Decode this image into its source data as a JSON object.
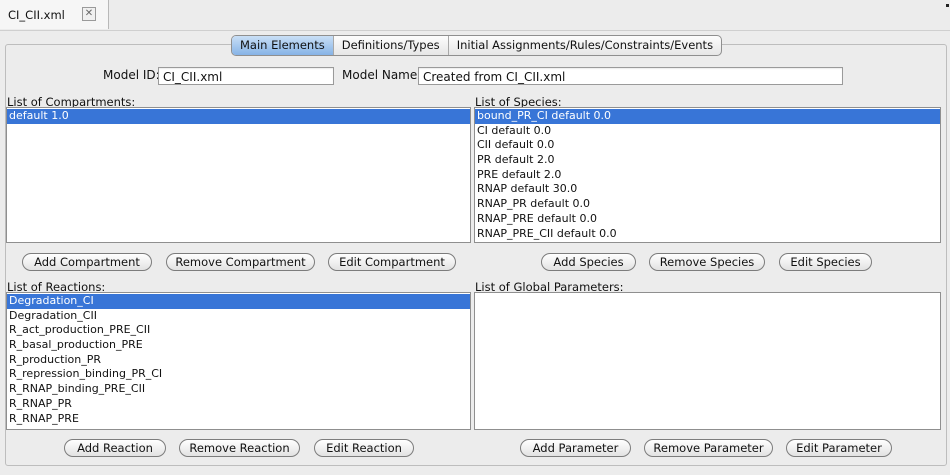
{
  "doc_tab": {
    "title": "CI_CII.xml",
    "close_icon": "close-icon"
  },
  "tabs": [
    {
      "label": "Main Elements",
      "active": true
    },
    {
      "label": "Definitions/Types",
      "active": false
    },
    {
      "label": "Initial Assignments/Rules/Constraints/Events",
      "active": false
    }
  ],
  "model": {
    "id_label": "Model ID:",
    "id_value": "CI_CII.xml",
    "name_label": "Model Name:",
    "name_value": "Created from CI_CII.xml"
  },
  "compartments": {
    "label": "List of Compartments:",
    "items": [
      "default 1.0"
    ],
    "selected_index": 0,
    "buttons": {
      "add": "Add Compartment",
      "remove": "Remove Compartment",
      "edit": "Edit Compartment"
    }
  },
  "species": {
    "label": "List of Species:",
    "items": [
      "bound_PR_CI default 0.0",
      "CI default 0.0",
      "CII default 0.0",
      "PR default 2.0",
      "PRE default 2.0",
      "RNAP default 30.0",
      "RNAP_PR default 0.0",
      "RNAP_PRE default 0.0",
      "RNAP_PRE_CII default 0.0"
    ],
    "selected_index": 0,
    "buttons": {
      "add": "Add Species",
      "remove": "Remove Species",
      "edit": "Edit Species"
    }
  },
  "reactions": {
    "label": "List of Reactions:",
    "items": [
      "Degradation_CI",
      "Degradation_CII",
      "R_act_production_PRE_CII",
      "R_basal_production_PRE",
      "R_production_PR",
      "R_repression_binding_PR_CI",
      "R_RNAP_binding_PRE_CII",
      "R_RNAP_PR",
      "R_RNAP_PRE"
    ],
    "selected_index": 0,
    "buttons": {
      "add": "Add Reaction",
      "remove": "Remove Reaction",
      "edit": "Edit Reaction"
    }
  },
  "parameters": {
    "label": "List of Global Parameters:",
    "items": [],
    "buttons": {
      "add": "Add Parameter",
      "remove": "Remove Parameter",
      "edit": "Edit Parameter"
    }
  },
  "colors": {
    "selection": "#3875d7",
    "active_tab": "#86b3e6"
  }
}
